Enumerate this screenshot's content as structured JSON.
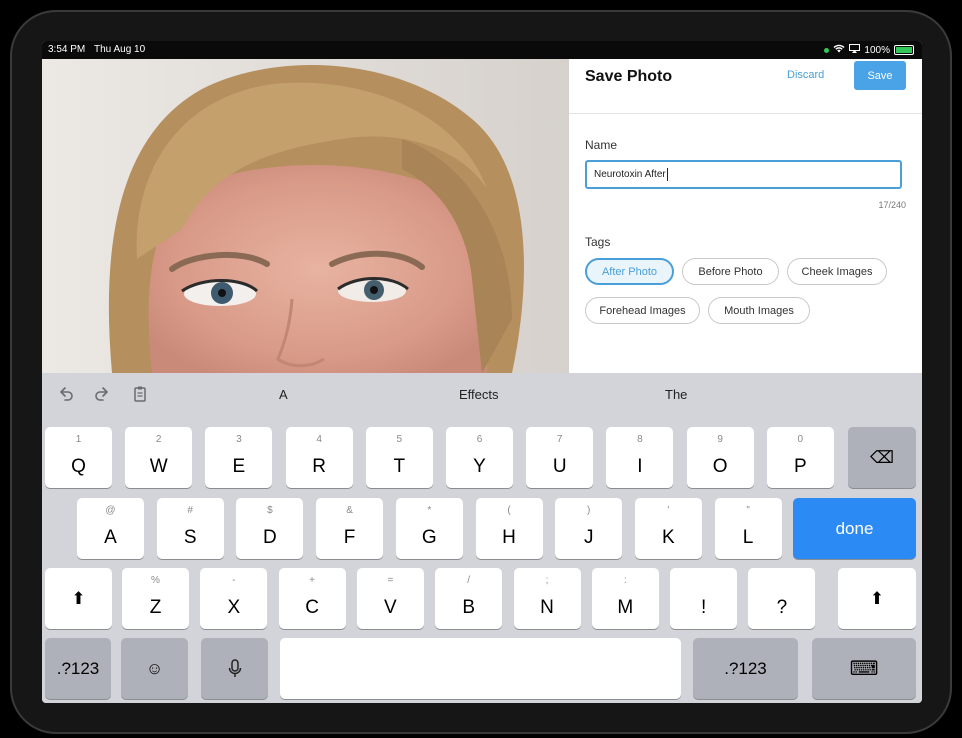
{
  "status": {
    "time": "3:54 PM",
    "date": "Thu Aug 10",
    "battery": "100%"
  },
  "panel": {
    "title": "Save Photo",
    "discard_label": "Discard",
    "save_label": "Save",
    "name_label": "Name",
    "name_value": "Neurotoxin After",
    "counter": "17/240",
    "tags_label": "Tags",
    "tags": [
      {
        "label": "After Photo",
        "selected": true
      },
      {
        "label": "Before Photo",
        "selected": false
      },
      {
        "label": "Cheek Images",
        "selected": false
      },
      {
        "label": "Forehead Images",
        "selected": false
      },
      {
        "label": "Mouth Images",
        "selected": false
      }
    ]
  },
  "keyboard": {
    "suggestions": [
      "A",
      "Effects",
      "The"
    ],
    "row1": [
      {
        "main": "Q",
        "hint": "1"
      },
      {
        "main": "W",
        "hint": "2"
      },
      {
        "main": "E",
        "hint": "3"
      },
      {
        "main": "R",
        "hint": "4"
      },
      {
        "main": "T",
        "hint": "5"
      },
      {
        "main": "Y",
        "hint": "6"
      },
      {
        "main": "U",
        "hint": "7"
      },
      {
        "main": "I",
        "hint": "8"
      },
      {
        "main": "O",
        "hint": "9"
      },
      {
        "main": "P",
        "hint": "0"
      }
    ],
    "row2": [
      {
        "main": "A",
        "hint": "@"
      },
      {
        "main": "S",
        "hint": "#"
      },
      {
        "main": "D",
        "hint": "$"
      },
      {
        "main": "F",
        "hint": "&"
      },
      {
        "main": "G",
        "hint": "*"
      },
      {
        "main": "H",
        "hint": "("
      },
      {
        "main": "J",
        "hint": ")"
      },
      {
        "main": "K",
        "hint": "'"
      },
      {
        "main": "L",
        "hint": "\""
      }
    ],
    "row3": [
      {
        "main": "Z",
        "hint": "%"
      },
      {
        "main": "X",
        "hint": "-"
      },
      {
        "main": "C",
        "hint": "+"
      },
      {
        "main": "V",
        "hint": "="
      },
      {
        "main": "B",
        "hint": "/"
      },
      {
        "main": "N",
        "hint": ";"
      },
      {
        "main": "M",
        "hint": ":"
      },
      {
        "main": "!",
        "hint": ""
      },
      {
        "main": "?",
        "hint": ""
      }
    ],
    "done_label": "done",
    "numbers_label": ".?123",
    "shift_glyph": "⬆",
    "delete_glyph": "⌫",
    "emoji_glyph": "☺",
    "mic_glyph": "🎤",
    "hide_glyph": "⌨"
  }
}
